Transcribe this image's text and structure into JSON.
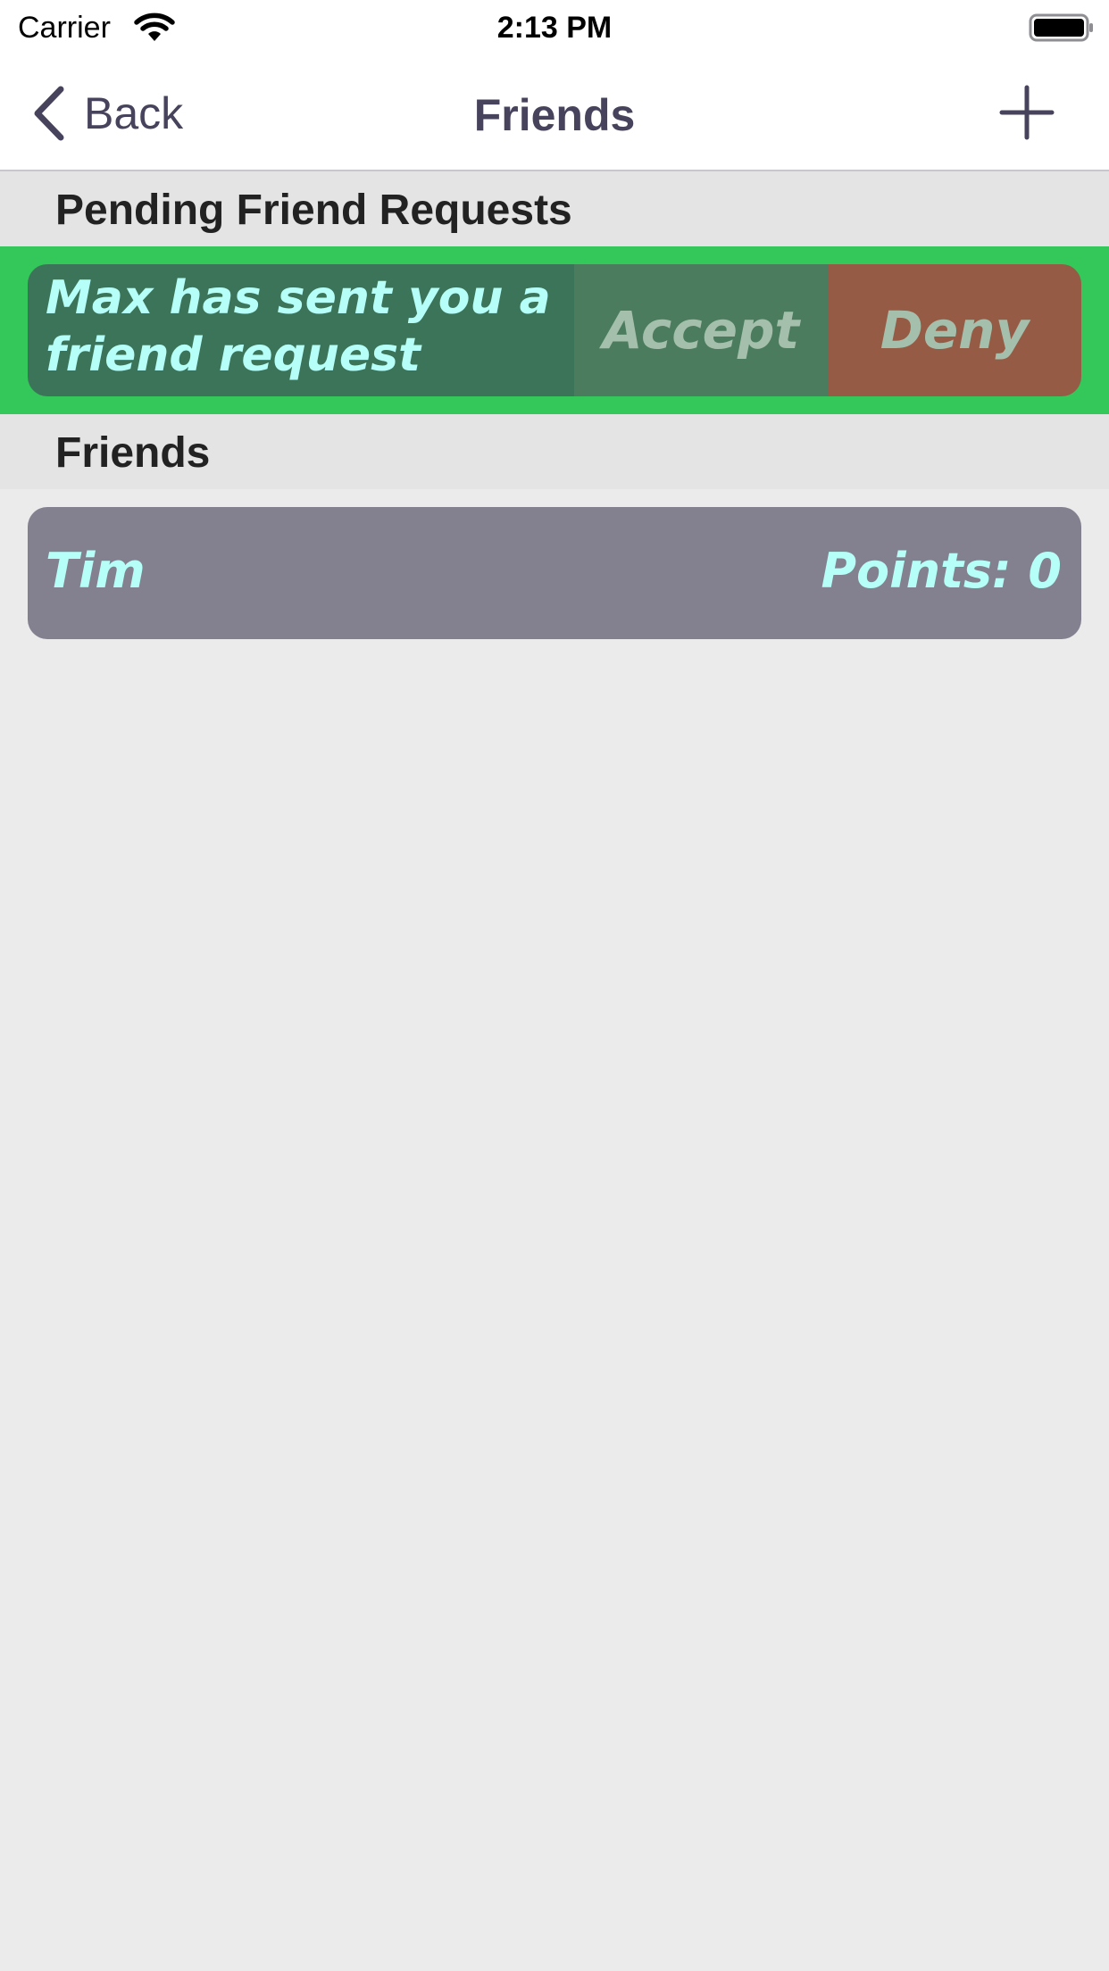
{
  "status_bar": {
    "carrier": "Carrier",
    "time": "2:13 PM",
    "wifi_icon": "wifi-icon",
    "battery_icon": "battery-icon"
  },
  "nav": {
    "back_label": "Back",
    "back_icon": "chevron-left-icon",
    "title": "Friends",
    "add_icon": "plus-icon"
  },
  "pending": {
    "header": "Pending Friend Requests",
    "requests": [
      {
        "message": "Max has sent you a friend request",
        "accept_label": "Accept",
        "deny_label": "Deny"
      }
    ]
  },
  "friends": {
    "header": "Friends",
    "items": [
      {
        "name": "Tim",
        "points": "Points: 0"
      }
    ]
  },
  "colors": {
    "accent": "#48435c",
    "request_row_background": "#34c759",
    "card_text": "#b6fff8",
    "accept": "#4b7c5e",
    "deny": "#955b45",
    "friend_card": "#838190"
  }
}
